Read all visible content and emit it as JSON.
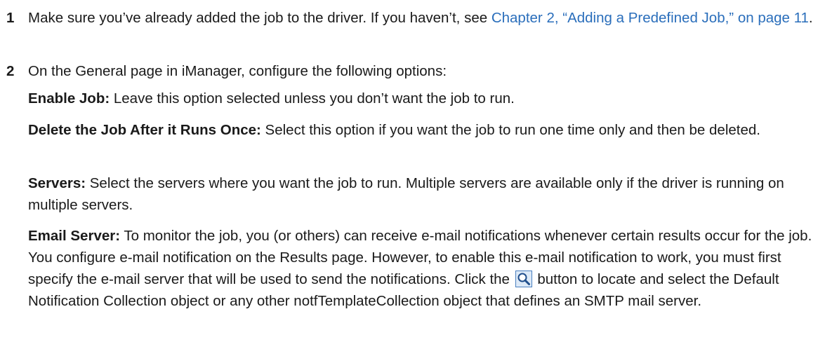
{
  "steps": [
    {
      "number": "1",
      "text_before": "Make sure you’ve already added the job to the driver. If you haven’t, see ",
      "link_text": "Chapter 2, “Adding a Predefined Job,” on page 11",
      "text_after": "."
    },
    {
      "number": "2",
      "text": "On the General page in iManager, configure the following options:"
    }
  ],
  "options": [
    {
      "term": "Enable Job:",
      "description": " Leave this option selected unless you don’t want the job to run."
    },
    {
      "term": "Delete the Job After it Runs Once:",
      "description": " Select this option if you want the job to run one time only and then be deleted."
    },
    {
      "term": "Servers:",
      "description": " Select the servers where you want the job to run. Multiple servers are available only if the driver is running on multiple servers."
    },
    {
      "term": "Email Server:",
      "description_before": " To monitor the job, you (or others) can receive e-mail notifications whenever certain results occur for the job. You configure e-mail notification on the Results page. However, to enable this e-mail notification to work, you must first specify the e-mail server that will be used to send the notifications. Click the ",
      "icon": "search-browse-icon",
      "description_after": " button to locate and select the Default Notification Collection object or any other notfTemplateCollection object that defines an SMTP mail server."
    }
  ],
  "colors": {
    "link": "#2a6ebb",
    "text": "#1a1a1a",
    "icon_border": "#4a7fbf",
    "icon_fill": "#dce9f7"
  }
}
